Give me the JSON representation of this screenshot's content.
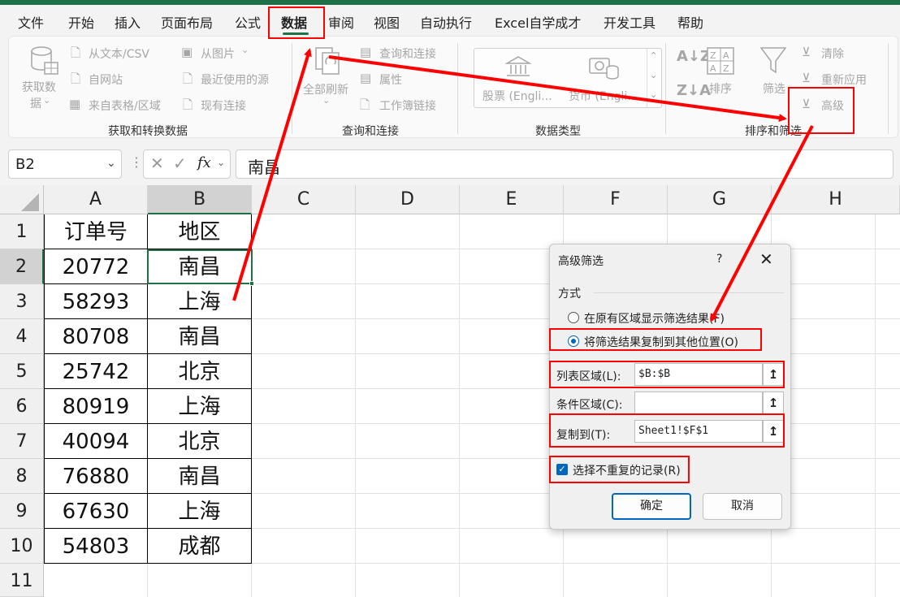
{
  "tabs": [
    "文件",
    "开始",
    "插入",
    "页面布局",
    "公式",
    "数据",
    "审阅",
    "视图",
    "自动执行",
    "Excel自学成才",
    "开发工具",
    "帮助"
  ],
  "ribbon": {
    "get_data": {
      "label_line1": "获取数",
      "label_line2": "据",
      "from_text_csv": "从文本/CSV",
      "from_web": "自网站",
      "from_table": "来自表格/区域",
      "from_picture": "从图片",
      "recent_sources": "最近使用的源",
      "existing_connections": "现有连接",
      "group_label": "获取和转换数据"
    },
    "queries": {
      "refresh_all": "全部刷新",
      "queries_connections": "查询和连接",
      "properties": "属性",
      "workbook_links": "工作簿链接",
      "group_label": "查询和连接"
    },
    "data_types": {
      "stocks": "股票 (Engli...",
      "currencies": "货币 (Engli...",
      "group_label": "数据类型"
    },
    "sort_filter": {
      "sort": "排序",
      "filter": "筛选",
      "clear": "清除",
      "reapply": "重新应用",
      "advanced": "高级",
      "group_label": "排序和筛选"
    }
  },
  "formula_bar": {
    "name_box": "B2",
    "fx": "fx",
    "value": "南昌"
  },
  "columns": [
    "A",
    "B",
    "C",
    "D",
    "E",
    "F",
    "G",
    "H"
  ],
  "rows": [
    "1",
    "2",
    "3",
    "4",
    "5",
    "6",
    "7",
    "8",
    "9",
    "10",
    "11"
  ],
  "table": [
    [
      "订单号",
      "地区"
    ],
    [
      "20772",
      "南昌"
    ],
    [
      "58293",
      "上海"
    ],
    [
      "80708",
      "南昌"
    ],
    [
      "25742",
      "北京"
    ],
    [
      "80919",
      "上海"
    ],
    [
      "40094",
      "北京"
    ],
    [
      "76880",
      "南昌"
    ],
    [
      "67630",
      "上海"
    ],
    [
      "54803",
      "成都"
    ]
  ],
  "dialog": {
    "title": "高级筛选",
    "help": "?",
    "close": "✕",
    "section": "方式",
    "option1": "在原有区域显示筛选结果(F)",
    "option2": "将筛选结果复制到其他位置(O)",
    "list_range_label": "列表区域(L):",
    "list_range_value": "$B:$B",
    "criteria_range_label": "条件区域(C):",
    "criteria_range_value": "",
    "copy_to_label": "复制到(T):",
    "copy_to_value": "Sheet1!$F$1",
    "unique_label": "选择不重复的记录(R)",
    "ok": "确定",
    "cancel": "取消"
  },
  "colors": {
    "accent": "#1e7145",
    "annotation": "#ff0000",
    "dialog_blue": "#0067c0"
  }
}
